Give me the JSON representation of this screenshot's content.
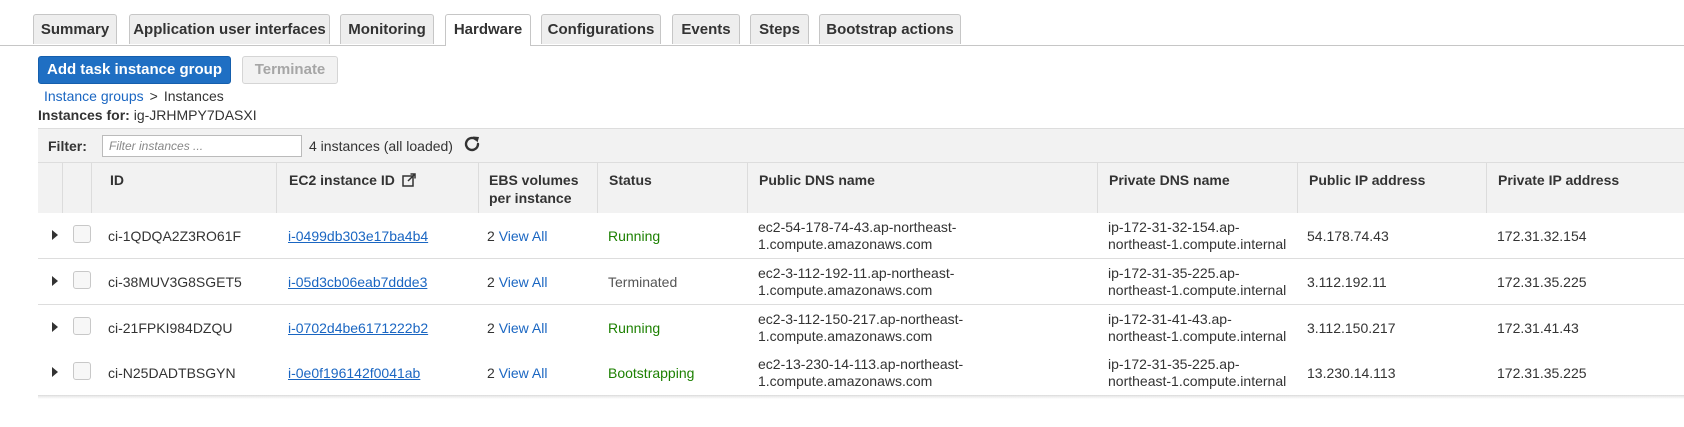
{
  "tabs": [
    {
      "label": "Summary",
      "active": false
    },
    {
      "label": "Application user interfaces",
      "active": false
    },
    {
      "label": "Monitoring",
      "active": false
    },
    {
      "label": "Hardware",
      "active": true
    },
    {
      "label": "Configurations",
      "active": false
    },
    {
      "label": "Events",
      "active": false
    },
    {
      "label": "Steps",
      "active": false
    },
    {
      "label": "Bootstrap actions",
      "active": false
    }
  ],
  "actions": {
    "add_label": "Add task instance group",
    "terminate_label": "Terminate"
  },
  "breadcrumb": {
    "parent": "Instance groups",
    "separator": ">",
    "current": "Instances"
  },
  "instances_for": {
    "label": "Instances for:",
    "value": "ig-JRHMPY7DASXI"
  },
  "filter": {
    "label": "Filter:",
    "placeholder": "Filter instances ...",
    "value": "",
    "count_text": "4 instances (all loaded)"
  },
  "table": {
    "columns": {
      "id": "ID",
      "ec2": "EC2 instance ID",
      "ebs_line1": "EBS volumes",
      "ebs_line2": "per instance",
      "status": "Status",
      "public_dns": "Public DNS name",
      "private_dns": "Private DNS name",
      "public_ip": "Public IP address",
      "private_ip": "Private IP address"
    },
    "rows": [
      {
        "id": "ci-1QDQA2Z3RO61F",
        "ec2": "i-0499db303e17ba4b4",
        "ebs_count": "2",
        "ebs_link": "View All",
        "status": "Running",
        "public_dns_1": "ec2-54-178-74-43.ap-northeast-",
        "public_dns_2": "1.compute.amazonaws.com",
        "private_dns_1": "ip-172-31-32-154.ap-",
        "private_dns_2": "northeast-1.compute.internal",
        "public_ip": "54.178.74.43",
        "private_ip": "172.31.32.154"
      },
      {
        "id": "ci-38MUV3G8SGET5",
        "ec2": "i-05d3cb06eab7ddde3",
        "ebs_count": "2",
        "ebs_link": "View All",
        "status": "Terminated",
        "public_dns_1": "ec2-3-112-192-11.ap-northeast-",
        "public_dns_2": "1.compute.amazonaws.com",
        "private_dns_1": "ip-172-31-35-225.ap-",
        "private_dns_2": "northeast-1.compute.internal",
        "public_ip": "3.112.192.11",
        "private_ip": "172.31.35.225"
      },
      {
        "id": "ci-21FPKI984DZQU",
        "ec2": "i-0702d4be6171222b2",
        "ebs_count": "2",
        "ebs_link": "View All",
        "status": "Running",
        "public_dns_1": "ec2-3-112-150-217.ap-northeast-",
        "public_dns_2": "1.compute.amazonaws.com",
        "private_dns_1": "ip-172-31-41-43.ap-",
        "private_dns_2": "northeast-1.compute.internal",
        "public_ip": "3.112.150.217",
        "private_ip": "172.31.41.43"
      },
      {
        "id": "ci-N25DADTBSGYN",
        "ec2": "i-0e0f196142f0041ab",
        "ebs_count": "2",
        "ebs_link": "View All",
        "status": "Bootstrapping",
        "public_dns_1": "ec2-13-230-14-113.ap-northeast-",
        "public_dns_2": "1.compute.amazonaws.com",
        "private_dns_1": "ip-172-31-35-225.ap-",
        "private_dns_2": "northeast-1.compute.internal",
        "public_ip": "13.230.14.113",
        "private_ip": "172.31.35.225"
      }
    ]
  },
  "colors": {
    "primary_button": "#1f6fc3",
    "link": "#1a66c2",
    "status_running": "#1d8102",
    "status_terminated": "#555555",
    "status_bootstrapping": "#1d8102"
  },
  "icons": {
    "external_link": "external-link-icon",
    "refresh": "refresh-icon",
    "expand": "caret-right-icon"
  }
}
